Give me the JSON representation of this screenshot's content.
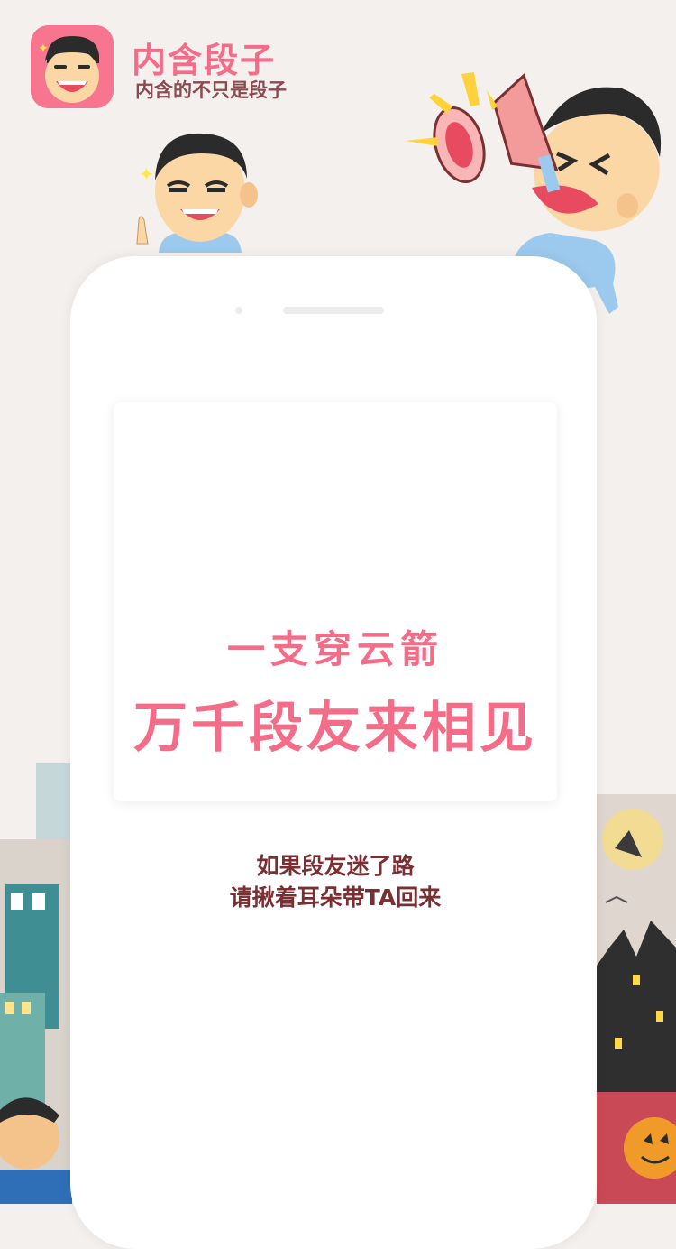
{
  "app": {
    "name": "内含段子",
    "slogan": "内含的不只是段子"
  },
  "screen": {
    "headline_line1": "一支穿云箭",
    "headline_line2": "万千段友来相见"
  },
  "tagline": {
    "line1": "如果段友迷了路",
    "line2": "请揪着耳朵带TA回来"
  },
  "colors": {
    "background": "#f3f0ee",
    "brand_pink": "#f36d89",
    "text_brown": "#7a2f33"
  }
}
